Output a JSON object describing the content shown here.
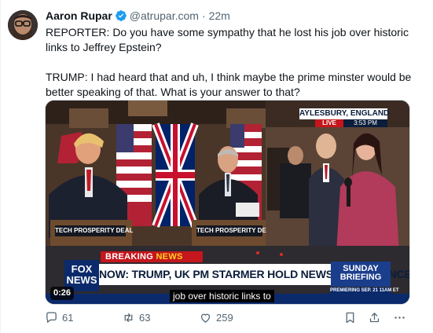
{
  "tweet": {
    "author": {
      "name": "Aaron Rupar",
      "handle": "@atrupar.com",
      "time": "22m",
      "verified": true,
      "verified_color": "#1d9bf0"
    },
    "text": {
      "para1": "REPORTER: Do you have some sympathy that he lost his job over historic links to Jeffrey Epstein?",
      "para2": "TRUMP: I had heard that and uh, I think maybe the prime minster would be better speaking of that. What is your answer to that?"
    }
  },
  "video": {
    "duration": "0:26",
    "breaking": "BREAKING",
    "news": "NEWS",
    "headline": "NOW: TRUMP, UK PM STARMER HOLD NEWS CONFERENCE",
    "network_line1": "FOX",
    "network_line2": "NEWS",
    "show_line1": "SUNDAY",
    "show_line2": "BRIEFING",
    "show_subtitle": "PREMIERING SEP. 21 11AM ET",
    "location": "AYLESBURY, ENGLAND",
    "live": "LIVE",
    "live_time": "3:53 PM",
    "podium_left": "TECH PROSPERITY DEAL",
    "podium_right": "TECH PROSPERITY DE",
    "caption": "job over historic links to"
  },
  "actions": {
    "reply_count": "61",
    "repost_count": "63",
    "like_count": "259"
  },
  "colors": {
    "text_primary": "#0f1419",
    "text_secondary": "#536471",
    "breaking_red": "#c4161c",
    "fox_blue": "#0b2a6b"
  },
  "icons": [
    "verified-badge-icon",
    "reply-icon",
    "repost-icon",
    "like-icon",
    "bookmark-icon",
    "share-icon",
    "more-icon"
  ]
}
